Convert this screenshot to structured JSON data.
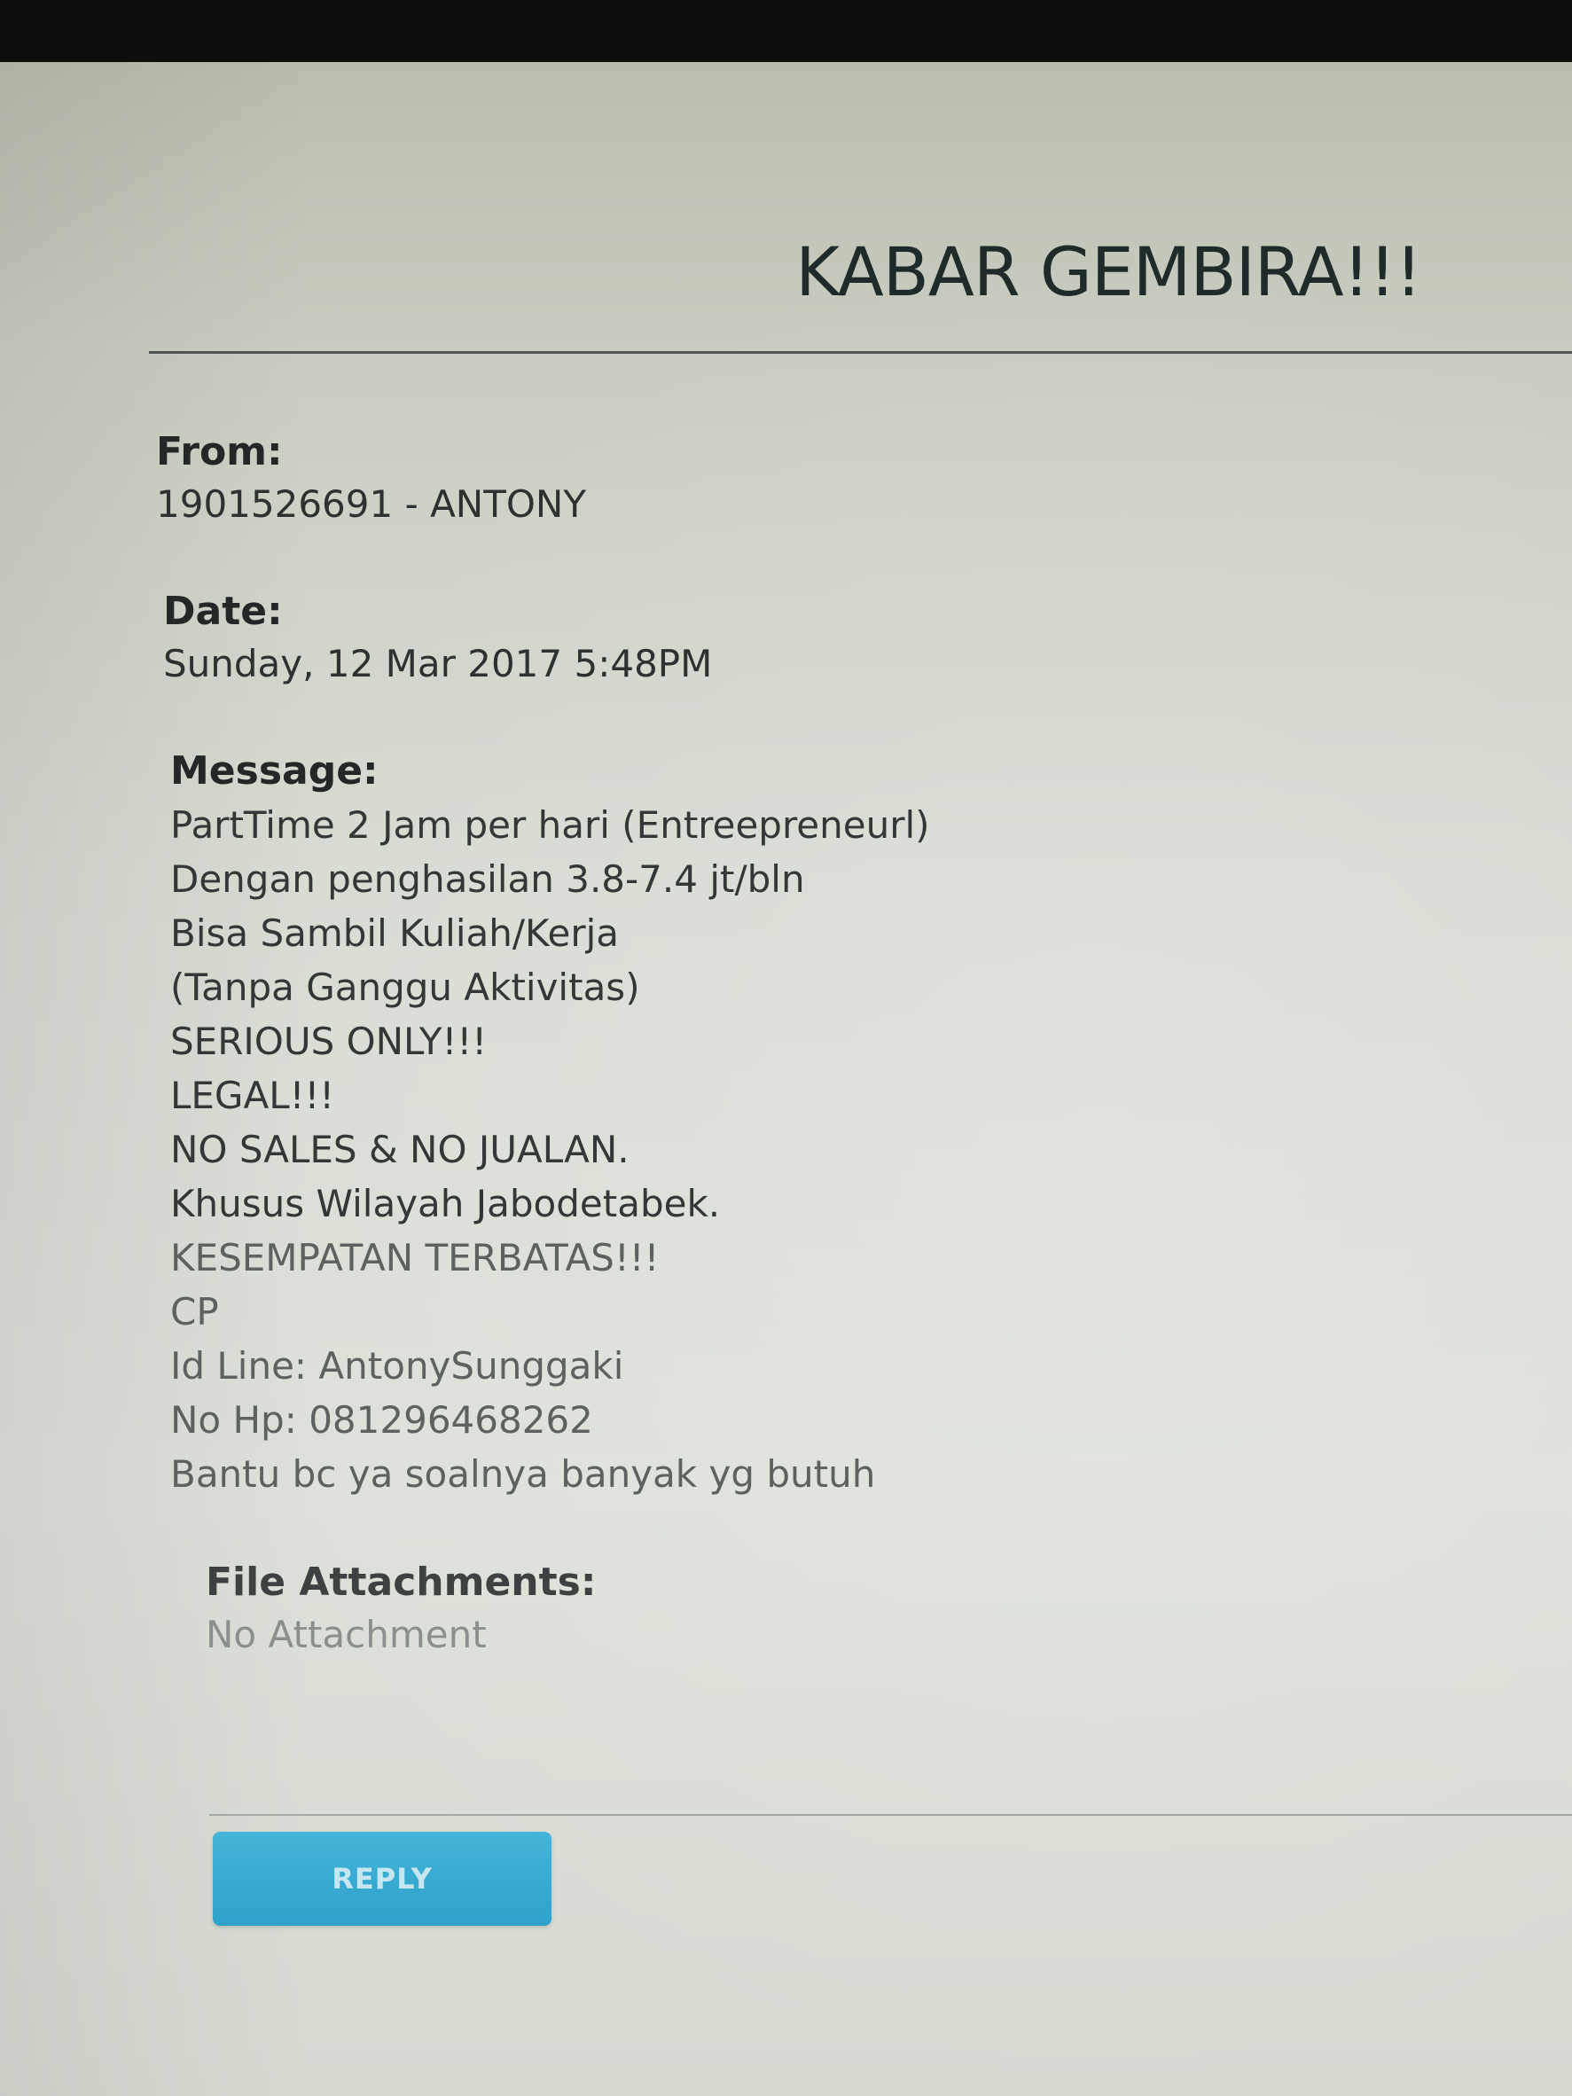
{
  "message": {
    "subject": "KABAR GEMBIRA!!!",
    "from_label": "From:",
    "from_value": "1901526691 - ANTONY",
    "date_label": "Date:",
    "date_value": "Sunday, 12 Mar 2017 5:48PM",
    "message_label": "Message:",
    "body_lines": [
      "PartTime 2 Jam per hari (Entreepreneurl)",
      "Dengan penghasilan 3.8-7.4 jt/bln",
      "Bisa Sambil Kuliah/Kerja",
      "(Tanpa Ganggu Aktivitas)",
      "SERIOUS ONLY!!!",
      "LEGAL!!!",
      "NO SALES & NO JUALAN.",
      "Khusus Wilayah Jabodetabek.",
      "KESEMPATAN TERBATAS!!!",
      "CP",
      "Id Line: AntonySunggaki",
      "No Hp: 081296468262",
      "Bantu bc ya soalnya banyak yg butuh"
    ],
    "attachments_label": "File Attachments:",
    "attachments_value": "No Attachment",
    "reply_label": "REPLY"
  }
}
